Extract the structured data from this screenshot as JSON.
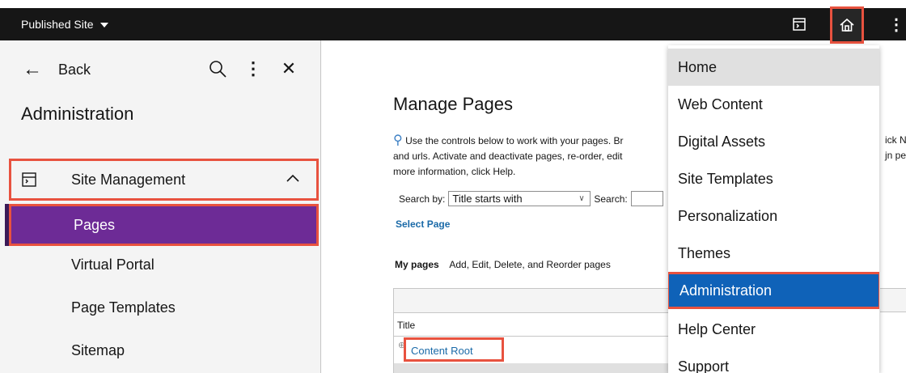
{
  "topbar": {
    "site_label": "Published Site",
    "icons": [
      "caret-down-icon",
      "side-panel-icon",
      "home-icon",
      "overflow-menu-icon"
    ]
  },
  "side_panel": {
    "back_label": "Back",
    "title": "Administration",
    "section": {
      "label": "Site Management",
      "icon": "site-management-icon",
      "expanded": true
    },
    "items": [
      {
        "label": "Pages",
        "selected": true
      },
      {
        "label": "Virtual Portal"
      },
      {
        "label": "Page Templates"
      },
      {
        "label": "Sitemap"
      }
    ],
    "icons": [
      "back-arrow-icon",
      "search-icon",
      "overflow-menu-icon",
      "close-icon",
      "chevron-up-icon"
    ]
  },
  "main": {
    "title": "Manage Pages",
    "help_line1": "Use the controls below to work with your pages. Br",
    "help_line2": "and urls. Activate and deactivate pages, re-order, edit",
    "help_line3": "more information, click Help.",
    "right_frag1": "ick N",
    "right_frag2": "jn pe",
    "search_by_label": "Search by:",
    "search_by_value": "Title starts with",
    "search_label": "Search:",
    "search_value": "",
    "select_page_link": "Select Page",
    "my_pages_label": "My pages",
    "my_pages_desc": "Add, Edit, Delete, and Reorder pages",
    "table": {
      "column_title": "Title",
      "rows": [
        {
          "label": "Content Root"
        }
      ]
    }
  },
  "menu": {
    "items": [
      {
        "label": "Home",
        "state": "hover"
      },
      {
        "label": "Web Content"
      },
      {
        "label": "Digital Assets"
      },
      {
        "label": "Site Templates"
      },
      {
        "label": "Personalization"
      },
      {
        "label": "Themes"
      },
      {
        "label": "Administration",
        "state": "active"
      },
      {
        "label": "Help Center"
      },
      {
        "label": "Support"
      }
    ]
  },
  "colors": {
    "topbar_bg": "#161616",
    "selected_item_bg": "#6d2b96",
    "highlight_border": "#e8523f",
    "menu_active_bg": "#0f62b8",
    "link": "#1a6aa8"
  }
}
